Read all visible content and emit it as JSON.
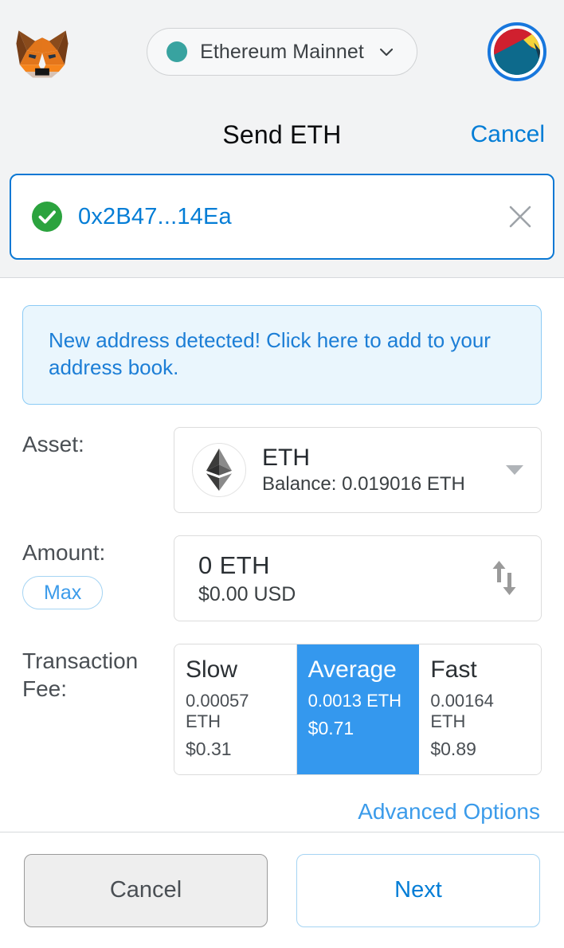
{
  "header": {
    "logo_name": "metamask-fox-logo",
    "network": {
      "name": "Ethereum Mainnet",
      "dot_color": "#38a3a0",
      "chevron_icon": "chevron-down-icon"
    },
    "avatar_name": "account-identicon",
    "avatar_ring_color": "#1877dd"
  },
  "page": {
    "title": "Send ETH",
    "cancel_label": "Cancel"
  },
  "recipient": {
    "address": "0x2B47...14Ea",
    "valid_icon": "check-circle-icon",
    "valid_color": "#2ba33e",
    "clear_icon": "close-icon",
    "border_color": "#0a78d4"
  },
  "notice": {
    "text": "New address detected! Click here to add to your address book.",
    "text_color": "#1c7ed6",
    "background": "#eaf6fd",
    "border_color": "#8ccbf5"
  },
  "asset": {
    "label": "Asset:",
    "token_icon": "ethereum-token-icon",
    "symbol": "ETH",
    "balance": "Balance: 0.019016 ETH",
    "dropdown_icon": "caret-down-icon"
  },
  "amount": {
    "label": "Amount:",
    "max_label": "Max",
    "value": "0  ETH",
    "fiat_value": "$0.00 USD",
    "swap_icon": "swap-vertical-arrows-icon"
  },
  "transaction_fee": {
    "label": "Transaction Fee:",
    "selected_index": 1,
    "selected_color": "#3498ee",
    "options": [
      {
        "name": "Slow",
        "eth": "0.00057 ETH",
        "fiat": "$0.31"
      },
      {
        "name": "Average",
        "eth": "0.0013 ETH",
        "fiat": "$0.71"
      },
      {
        "name": "Fast",
        "eth": "0.00164 ETH",
        "fiat": "$0.89"
      }
    ]
  },
  "advanced": {
    "label": "Advanced Options",
    "color": "#3b9bea"
  },
  "footer": {
    "cancel_label": "Cancel",
    "next_label": "Next"
  }
}
